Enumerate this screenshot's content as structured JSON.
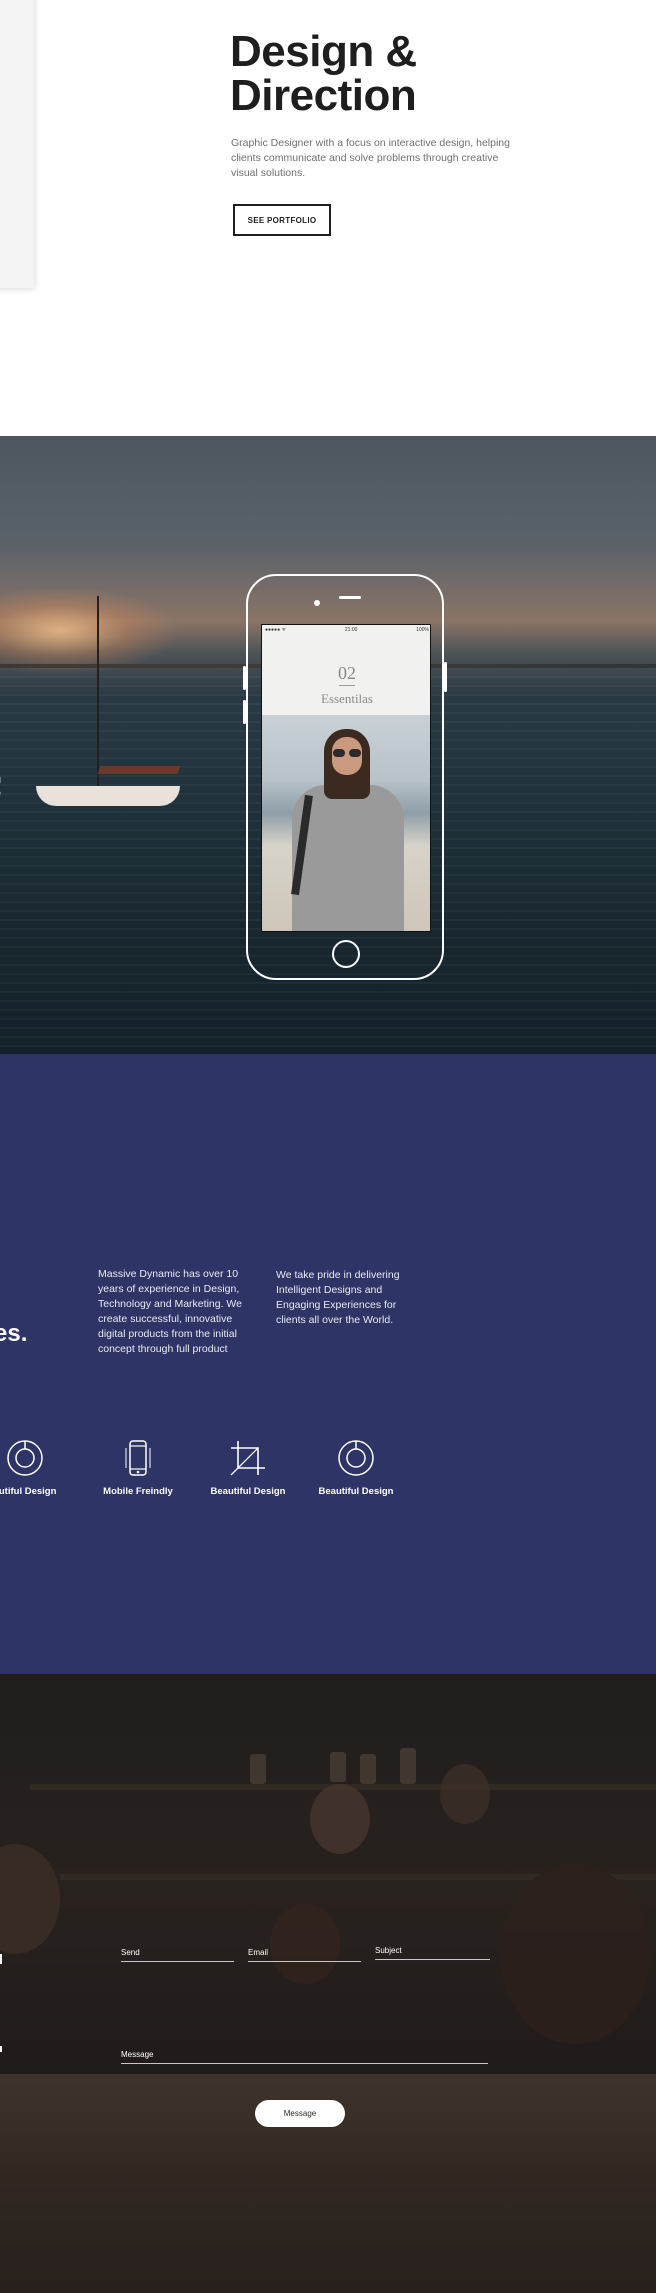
{
  "hero": {
    "title_line1": "Design &",
    "title_line2": "Direction",
    "description": "Graphic Designer with a focus on interactive design, helping clients communicate and solve problems through creative visual solutions.",
    "button_label": "SEE PORTFOLIO"
  },
  "showcase": {
    "side_text_line1": "g",
    "side_text_line2": "e",
    "phone": {
      "status_carrier": "●●●●● ᯤ",
      "status_time": "21:00",
      "status_battery": "100%",
      "screen_number": "02",
      "screen_title": "Essentilas"
    }
  },
  "about": {
    "col1_text": "Massive Dynamic has over 10 years of experience in Design, Technology and Marketing. We create successful, innovative digital products from the initial concept through full product",
    "col2_text": "We take pride in delivering Intelligent Designs and Engaging Experiences for clients all over the World.",
    "heading_fragment": "es.",
    "features": [
      {
        "label": "autiful Design",
        "icon": "ring-icon"
      },
      {
        "label": "Mobile Freindly",
        "icon": "smartphone-icon"
      },
      {
        "label": "Beautiful Design",
        "icon": "crop-icon"
      },
      {
        "label": "Beautiful Design",
        "icon": "ring-icon"
      }
    ]
  },
  "contact": {
    "fields": {
      "send_label": "Send",
      "email_label": "Email",
      "subject_label": "Subject",
      "message_label": "Message"
    },
    "submit_label": "Message"
  },
  "colors": {
    "about_bg": "#2e3466",
    "hero_text": "#1e1e1e",
    "accent_white": "#ffffff"
  }
}
